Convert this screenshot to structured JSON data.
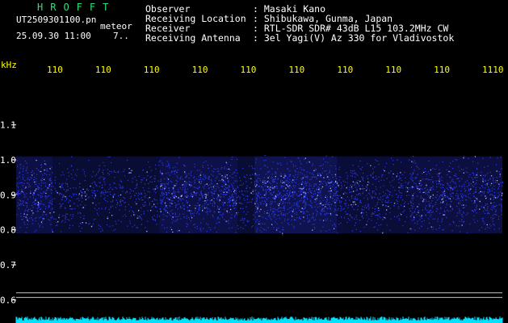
{
  "header": {
    "brand": "HROFFT",
    "filename": "UT2509301100.pn",
    "meteor_label": "meteor",
    "datetime": "25.09.30 11:00",
    "count": "7.."
  },
  "info": [
    {
      "label": "Observer",
      "value": ": Masaki Kano"
    },
    {
      "label": "Receiving Location",
      "value": ": Shibukawa, Gunma, Japan"
    },
    {
      "label": "Receiver",
      "value": ": RTL-SDR SDR# 43dB L15 103.2MHz CW"
    },
    {
      "label": "Receiving Antenna",
      "value": ": 3el Yagi(V) Az 330 for Vladivostok"
    }
  ],
  "colors": {
    "time_tick": "#ffff00",
    "freq_tick": "#ffffff",
    "noise": "#2b38e8",
    "noise_bright": "#aab4ff",
    "baseline": "#00e0ff",
    "guide": "#dcdcdc"
  },
  "chart_data": {
    "type": "heatmap",
    "ylabel": "kHz",
    "time_ticks": [
      "110",
      "110",
      "110",
      "110",
      "110",
      "110",
      "110",
      "110",
      "110",
      "1110"
    ],
    "freq_ticks": [
      {
        "value": 1.1,
        "label": "1.1"
      },
      {
        "value": 1.0,
        "label": "1.0"
      },
      {
        "value": 0.9,
        "label": "0.9"
      },
      {
        "value": 0.8,
        "label": "0.8"
      },
      {
        "value": 0.7,
        "label": "0.7"
      },
      {
        "value": 0.6,
        "label": "0.6"
      }
    ],
    "ylim": [
      0.58,
      1.18
    ],
    "noise_band_khz": [
      0.79,
      1.01
    ],
    "guide_lines_khz": [
      0.62,
      0.607
    ],
    "time_minutes": [
      0,
      10
    ],
    "segments": [
      {
        "start": 0.0,
        "end": 0.75,
        "intensity": 0.8
      },
      {
        "start": 0.75,
        "end": 2.95,
        "intensity": 0.45
      },
      {
        "start": 2.95,
        "end": 4.55,
        "intensity": 0.85
      },
      {
        "start": 4.55,
        "end": 4.9,
        "intensity": 0.45
      },
      {
        "start": 4.9,
        "end": 6.6,
        "intensity": 1.0
      },
      {
        "start": 6.6,
        "end": 8.1,
        "intensity": 0.55
      },
      {
        "start": 8.1,
        "end": 10.0,
        "intensity": 0.7
      }
    ]
  }
}
